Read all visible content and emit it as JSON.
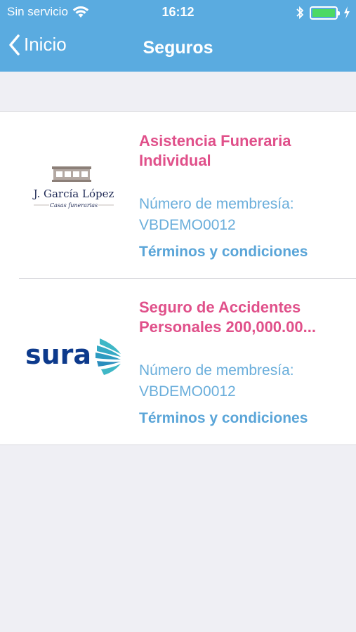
{
  "status_bar": {
    "carrier": "Sin servicio",
    "time": "16:12",
    "icons": [
      "wifi-icon",
      "bluetooth-icon",
      "battery-icon",
      "charging-bolt-icon"
    ],
    "battery_color": "#4cd964"
  },
  "nav": {
    "back_label": "Inicio",
    "title": "Seguros",
    "background": "#5aabe0"
  },
  "insurances": [
    {
      "title": "Asistencia Funeraria Individual",
      "logo_name": "J. García López",
      "logo_tagline": "Casas funerarias",
      "membership_label": "Número de membresía:",
      "membership_value": "VBDEMO0012",
      "terms_label": "Términos y condiciones"
    },
    {
      "title": "Seguro de Accidentes Personales 200,000.00...",
      "logo_name": "sura",
      "membership_label": "Número de membresía:",
      "membership_value": "VBDEMO0012",
      "terms_label": "Términos y condiciones"
    }
  ],
  "colors": {
    "title": "#e0508a",
    "link": "#5aa5d8",
    "label": "#6aaedb"
  }
}
